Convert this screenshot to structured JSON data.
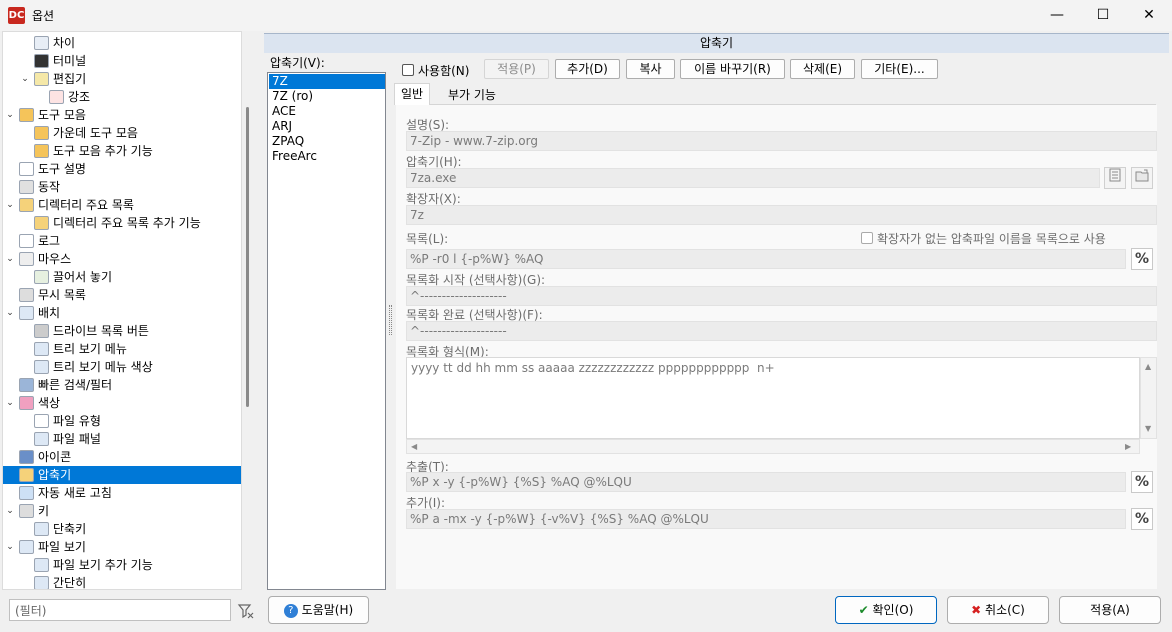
{
  "window": {
    "title": "옵션",
    "app_icon": "DC",
    "min_label": "—",
    "max_label": "☐",
    "close_label": "✕"
  },
  "tree": {
    "items": [
      {
        "label": "차이",
        "icon": "diff-icon",
        "level": 2
      },
      {
        "label": "터미널",
        "icon": "terminal-icon",
        "level": 2
      },
      {
        "label": "편집기",
        "icon": "editor-icon",
        "level": 2,
        "expander": "⌄"
      },
      {
        "label": "강조",
        "icon": "highlight-icon",
        "level": 3
      },
      {
        "label": "도구 모음",
        "icon": "toolbar-icon",
        "level": 1,
        "expander": "⌄"
      },
      {
        "label": "가운데 도구 모음",
        "icon": "toolbar-icon",
        "level": 2
      },
      {
        "label": "도구 모음 추가 기능",
        "icon": "toolbar-icon",
        "level": 2
      },
      {
        "label": "도구 설명",
        "icon": "tooltip-icon",
        "level": 1
      },
      {
        "label": "동작",
        "icon": "behavior-icon",
        "level": 1
      },
      {
        "label": "디렉터리 주요 목록",
        "icon": "folder-icon",
        "level": 1,
        "expander": "⌄"
      },
      {
        "label": "디렉터리 주요 목록 추가 기능",
        "icon": "folder-icon",
        "level": 2
      },
      {
        "label": "로그",
        "icon": "log-icon",
        "level": 1
      },
      {
        "label": "마우스",
        "icon": "mouse-icon",
        "level": 1,
        "expander": "⌄"
      },
      {
        "label": "끌어서 놓기",
        "icon": "drag-drop-icon",
        "level": 2
      },
      {
        "label": "무시 목록",
        "icon": "ignore-list-icon",
        "level": 1
      },
      {
        "label": "배치",
        "icon": "layout-icon",
        "level": 1,
        "expander": "⌄"
      },
      {
        "label": "드라이브 목록 버튼",
        "icon": "drive-list-icon",
        "level": 2
      },
      {
        "label": "트리 보기 메뉴",
        "icon": "tree-menu-icon",
        "level": 2
      },
      {
        "label": "트리 보기 메뉴 색상",
        "icon": "tree-menu-color-icon",
        "level": 2
      },
      {
        "label": "빠른 검색/필터",
        "icon": "quick-search-icon",
        "level": 1
      },
      {
        "label": "색상",
        "icon": "color-wheel-icon",
        "level": 1,
        "expander": "⌄"
      },
      {
        "label": "파일 유형",
        "icon": "file-types-icon",
        "level": 2
      },
      {
        "label": "파일 패널",
        "icon": "file-panel-icon",
        "level": 2
      },
      {
        "label": "아이콘",
        "icon": "icons-icon",
        "level": 1
      },
      {
        "label": "압축기",
        "icon": "archiver-icon",
        "level": 1,
        "selected": true
      },
      {
        "label": "자동 새로 고침",
        "icon": "refresh-icon",
        "level": 1
      },
      {
        "label": "키",
        "icon": "keyboard-icon",
        "level": 1,
        "expander": "⌄"
      },
      {
        "label": "단축키",
        "icon": "hotkey-icon",
        "level": 2
      },
      {
        "label": "파일 보기",
        "icon": "file-view-icon",
        "level": 1,
        "expander": "⌄"
      },
      {
        "label": "파일 보기 추가 기능",
        "icon": "file-view-icon",
        "level": 2
      },
      {
        "label": "간단히",
        "icon": "brief-view-icon",
        "level": 2
      }
    ]
  },
  "filter": {
    "placeholder": "(필터)"
  },
  "panel": {
    "header": "압축기"
  },
  "archiver_list": {
    "label": "압축기(V):",
    "items": [
      "7Z",
      "7Z (ro)",
      "ACE",
      "ARJ",
      "ZPAQ",
      "FreeArc"
    ],
    "selected_index": 0
  },
  "toolbar": {
    "enabled_label": "사용함(N)",
    "apply_label": "적용(P)",
    "add_label": "추가(D)",
    "copy_label": "복사",
    "rename_label": "이름 바꾸기(R)",
    "delete_label": "삭제(E)",
    "other_label": "기타(E)..."
  },
  "tabs": [
    "일반",
    "부가 기능"
  ],
  "form": {
    "description_label": "설명(S):",
    "description_value": "7-Zip - www.7-zip.org",
    "archiver_label": "압축기(H):",
    "archiver_value": "7za.exe",
    "extension_label": "확장자(X):",
    "extension_value": "7z",
    "list_label": "목록(L):",
    "no_ext_label": "확장자가 없는 압축파일 이름을 목록으로 사용",
    "list_value": "%P -r0 l {-p%W} %AQ",
    "list_start_label": "목록화 시작 (선택사항)(G):",
    "list_start_value": "^--------------------",
    "list_end_label": "목록화 완료 (선택사항)(F):",
    "list_end_value": "^--------------------",
    "list_format_label": "목록화 형식(M):",
    "list_format_value": "yyyy tt dd hh mm ss aaaaa zzzzzzzzzzzz pppppppppppp  n+",
    "extract_label": "추출(T):",
    "extract_value": "%P x -y {-p%W} {%S} %AQ @%LQU",
    "add_label": "추가(I):",
    "add_value": "%P a -mx -y {-p%W} {-v%V} {%S} %AQ @%LQU",
    "percent_symbol": "%"
  },
  "bottom": {
    "help_label": "도움말(H)",
    "ok_label": "확인(O)",
    "cancel_label": "취소(C)",
    "apply_label": "적용(A)"
  }
}
